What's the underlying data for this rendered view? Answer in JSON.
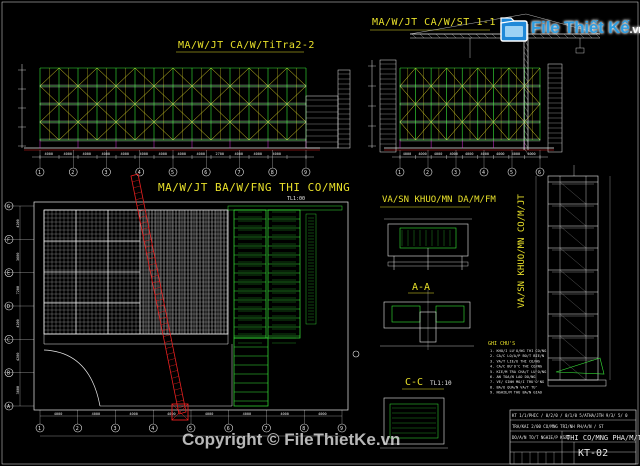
{
  "logo": {
    "text": "File Thiết Kế",
    "suffix": ".vn",
    "icon": "folder-icon"
  },
  "watermark": {
    "copyright": "Copyright © FileThietKe.vn"
  },
  "titles": {
    "elev_left": "MA/W/JT CA/W/TiTra2-2",
    "elev_right": "MA/W/JT CA/W/ST 1-1",
    "plan": "MA/W/JT BA/W/FNG THI CO/MNG",
    "plan_scale": "TL1:00",
    "detail_top": "VA/SN KHUO/MN DA/M/FM",
    "detail_vertical": "VA/SN KHUO/MN CO/M/JT",
    "section_aa": "A-A",
    "section_cc": "C-C",
    "section_cc_scale": "TL1:10",
    "notes_heading": "GHI CHU'S"
  },
  "title_block": {
    "line1": "KT 1/1/PHIC / 0/2/0 / 0/1/0 5/ATHA/JTH 9/3/ 5/ 0",
    "line2": "TRA/KAI 2/00 CO/MNG TRI/NH PH/A/N / ST",
    "line3": "DO/A/N TO/T NGHIE/P KSXD",
    "project": "THI CO/MNG PHA/M/TN",
    "sheet": "KT-02"
  },
  "axis_labels_elev": [
    "1",
    "2",
    "3",
    "4",
    "5",
    "6",
    "7",
    "8",
    "9"
  ],
  "axis_labels_plan_x": [
    "1",
    "2",
    "3",
    "4",
    "5",
    "6",
    "7",
    "8",
    "9"
  ],
  "axis_labels_plan_y": [
    "G",
    "F",
    "E",
    "D",
    "C",
    "B",
    "A"
  ],
  "dim_elev": [
    "4000",
    "4000",
    "4000",
    "4000",
    "4000",
    "4000",
    "4000",
    "4000",
    "4000",
    "2700",
    "4000",
    "4000",
    "4000"
  ],
  "dim_plan_bottom": [
    "4000",
    "4000",
    "4000",
    "4000",
    "4000",
    "4000",
    "4000",
    "4000"
  ],
  "dim_plan_left": [
    "4200",
    "3600",
    "7200",
    "4200",
    "4200",
    "3600"
  ],
  "notes": [
    "1. KHO/I LU'O/NG THI CO/NG",
    "2. CA/C LO/A/P BO/T BIE/N",
    "3. VA/T LIE/U THI CO/NG",
    "4. CA/C BU'O'C THI CO/NG",
    "5. KIE/M TRA CHA/T LU'O/NG",
    "6. AN TOA/N LAO DO/NG",
    "7. VE/ SINH MO/I TRU'O'NG",
    "8. BA/O QUA/N VA/T TU'",
    "9. NGHIE/M THU BA/N GIAO"
  ],
  "colors": {
    "background": "#000000",
    "frame": "#c8c8c8",
    "green": "#38e838",
    "yellow": "#e8e02a",
    "red": "#e82020",
    "cyan": "#30d8e0",
    "magenta": "#e030e0",
    "white": "#e8e8e8"
  }
}
